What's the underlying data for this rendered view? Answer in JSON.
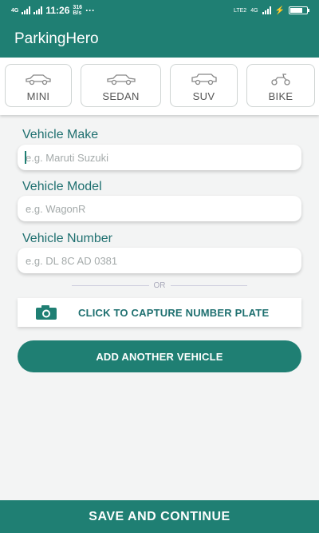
{
  "status_bar": {
    "network_left": "4G",
    "time": "11:26",
    "speed": "316",
    "speed_unit": "B/s",
    "dots": "···",
    "lte": "LTE2",
    "network_right": "4G"
  },
  "app": {
    "title": "ParkingHero"
  },
  "vehicle_types": [
    {
      "label": "MINI",
      "icon": "hatchback-car-icon"
    },
    {
      "label": "SEDAN",
      "icon": "sedan-car-icon"
    },
    {
      "label": "SUV",
      "icon": "suv-car-icon"
    },
    {
      "label": "BIKE",
      "icon": "scooter-bike-icon"
    }
  ],
  "form": {
    "make_label": "Vehicle Make",
    "make_placeholder": "e.g. Maruti Suzuki",
    "model_label": "Vehicle Model",
    "model_placeholder": "e.g. WagonR",
    "number_label": "Vehicle Number",
    "number_placeholder": "e.g. DL 8C AD 0381"
  },
  "divider_text": "OR",
  "capture_label": "CLICK TO CAPTURE NUMBER PLATE",
  "add_vehicle_label": "ADD ANOTHER VEHICLE",
  "save_label": "SAVE AND CONTINUE",
  "colors": {
    "primary": "#1f7f73",
    "label": "#1f7070",
    "background": "#f3f4f4"
  }
}
